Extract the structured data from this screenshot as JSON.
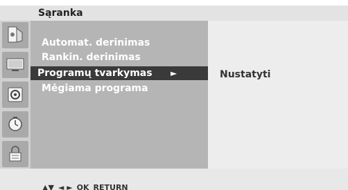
{
  "header": {
    "title": "Sąranka"
  },
  "sidebar": {
    "icons": [
      {
        "name": "picture-icon"
      },
      {
        "name": "tv-display-icon"
      },
      {
        "name": "speaker-icon"
      },
      {
        "name": "clock-icon"
      },
      {
        "name": "lock-icon"
      }
    ]
  },
  "menu": {
    "items": [
      {
        "label": "Automat. derinimas",
        "selected": false
      },
      {
        "label": "Rankin. derinimas",
        "selected": false
      },
      {
        "label": "Programų tvarkymas",
        "selected": true,
        "arrow": "►"
      },
      {
        "label": "Mėgiama programa",
        "selected": false
      }
    ]
  },
  "submenu": {
    "label": "Nustatyti"
  },
  "footer": {
    "updown": "▲▼",
    "leftright": "◄ ►",
    "ok": "OK",
    "return": "RETURN"
  },
  "colors": {
    "menu_bg": "#b5b5b5",
    "selected_bg": "#3a3a3a",
    "submenu_bg": "#ededed",
    "title_bg": "#e3e3e3"
  }
}
